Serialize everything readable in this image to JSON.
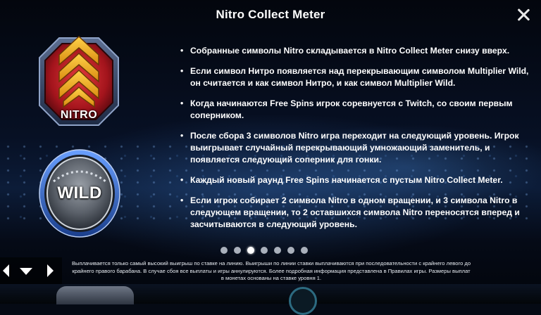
{
  "title": "Nitro Collect Meter",
  "symbols": {
    "nitro_label": "NITRO",
    "wild_label": "WILD"
  },
  "rules": [
    "Собранные символы Nitro складывается в Nitro Collect Meter снизу вверх.",
    "Если символ Нитро появляется над перекрывающим символом Multiplier Wild, он считается и как символ Нитро, и как символ Multiplier Wild.",
    "Когда начинаются Free Spins игрок соревнуется с Twitch, со своим первым соперником.",
    "После сбора 3 символов Nitro игра переходит на следующий уровень. Игрок выигрывает случайный перекрывающий умножающий заменитель, и появляется следующий соперник для гонки.",
    "Каждый новый раунд Free Spins начинается с пустым Nitro Collect Meter.",
    "Если игрок собирает 2 символа Nitro в одном вращении, и 3 символа Nitro в следующем вращении, то 2 оставшихся символа Nitro переносятся вперед и засчитываются в следующий уровень."
  ],
  "pagination": {
    "total_pages": 7,
    "current_page": 3
  },
  "footer_text": "Выплачивается только самый высокий выигрыш по ставке на линию. Выигрыши по линии ставки выплачиваются при последовательности с крайнего левого до крайнего правого барабана. В случае сбоя все выплаты и игры аннулируются. Более подробная информация представлена в Правилах игры. Размеры выплат в монетах основаны на ставке уровня 1.",
  "icons": {
    "close": "close-icon",
    "prev": "triangle-left-icon",
    "menu": "triangle-down-icon",
    "next": "triangle-right-icon"
  },
  "colors": {
    "nitro_red": "#c4262c",
    "nitro_chevron": "#f0b21e",
    "wild_silver": "#b9bec6",
    "wild_ring_blue": "#2f6bd8"
  }
}
